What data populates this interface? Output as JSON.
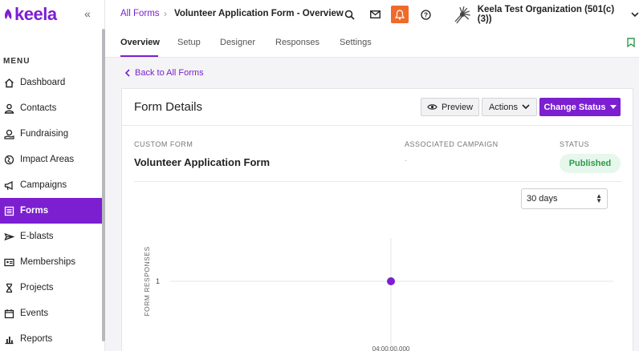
{
  "brand": {
    "name": "keela",
    "color": "#7b1fd1"
  },
  "sidebar": {
    "collapse_glyph": "«",
    "menu_label": "MENU",
    "items": [
      {
        "label": "Dashboard",
        "icon": "home-icon"
      },
      {
        "label": "Contacts",
        "icon": "person-icon"
      },
      {
        "label": "Fundraising",
        "icon": "hand-coin-icon"
      },
      {
        "label": "Impact Areas",
        "icon": "globe-icon"
      },
      {
        "label": "Campaigns",
        "icon": "megaphone-icon"
      },
      {
        "label": "Forms",
        "icon": "form-icon",
        "active": true
      },
      {
        "label": "E-blasts",
        "icon": "send-icon"
      },
      {
        "label": "Memberships",
        "icon": "id-card-icon"
      },
      {
        "label": "Projects",
        "icon": "hourglass-icon"
      },
      {
        "label": "Events",
        "icon": "calendar-icon"
      },
      {
        "label": "Reports",
        "icon": "bar-chart-icon"
      }
    ]
  },
  "header": {
    "breadcrumb_root": "All Forms",
    "breadcrumb_sep": "›",
    "breadcrumb_current": "Volunteer Application Form - Overview",
    "org_name": "Keela Test Organization (501(c)(3))",
    "icons": [
      "search-icon",
      "mail-icon",
      "bell-icon",
      "help-icon"
    ],
    "bell_color": "#f06a2a"
  },
  "tabs": [
    "Overview",
    "Setup",
    "Designer",
    "Responses",
    "Settings"
  ],
  "active_tab": "Overview",
  "back_link": "Back to All Forms",
  "card": {
    "title": "Form Details",
    "preview_label": "Preview",
    "actions_label": "Actions",
    "change_status_label": "Change Status",
    "custom_form_label": "CUSTOM FORM",
    "form_name": "Volunteer Application Form",
    "campaign_label": "ASSOCIATED CAMPAIGN",
    "campaign_value": "-",
    "status_label": "STATUS",
    "status_value": "Published",
    "range_select": "30 days"
  },
  "chart_data": {
    "type": "scatter",
    "ylabel": "FORM RESPONSES",
    "y_ticks": [
      1
    ],
    "x_tick_labels": [
      "04:00:00.000"
    ],
    "points": [
      {
        "x": "04:00:00.000",
        "y": 1
      }
    ],
    "point_color": "#7b1fd1",
    "grid": true
  }
}
